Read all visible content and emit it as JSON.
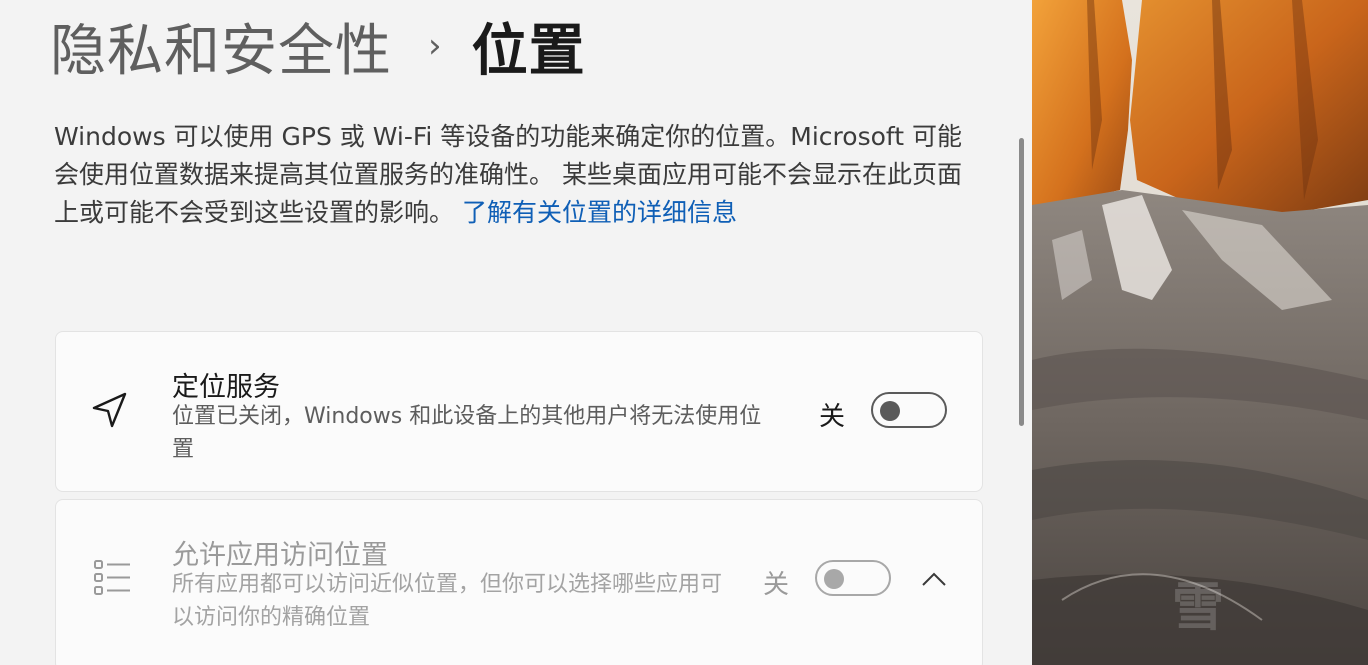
{
  "breadcrumb": {
    "parent": "隐私和安全性",
    "separator": "›",
    "current": "位置"
  },
  "description": {
    "text": "Windows 可以使用 GPS 或 Wi-Fi 等设备的功能来确定你的位置。Microsoft 可能会使用位置数据来提高其位置服务的准确性。 某些桌面应用可能不会显示在此页面上或可能不会受到这些设置的影响。 ",
    "link": "了解有关位置的详细信息"
  },
  "location_service": {
    "icon": "location-arrow-icon",
    "title": "定位服务",
    "subtitle": "位置已关闭，Windows 和此设备上的其他用户将无法使用位置",
    "state_label": "关",
    "toggle_on": false
  },
  "app_access": {
    "icon": "list-icon",
    "title": "允许应用访问位置",
    "subtitle": "所有应用都可以访问近似位置，但你可以选择哪些应用可以访问你的精确位置",
    "state_label": "关",
    "toggle_on": false,
    "expanded": true,
    "enabled": false
  },
  "wallpaper": {
    "watermark": "雪"
  },
  "colors": {
    "background": "#f3f3f3",
    "card": "#fbfbfb",
    "link": "#0f5fb6",
    "toggle_off": "#5a5a5a"
  }
}
